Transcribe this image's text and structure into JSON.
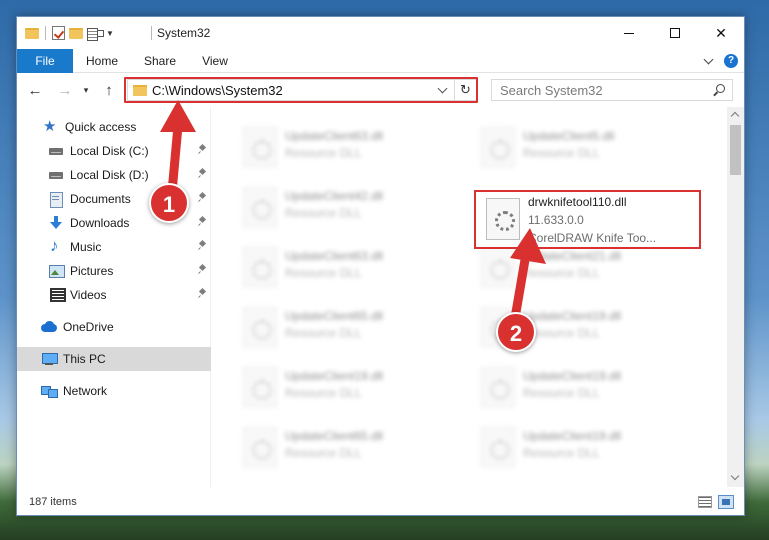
{
  "window": {
    "title": "System32",
    "controls": {
      "minimize": "—",
      "maximize": "☐",
      "close": "✕"
    }
  },
  "ribbon": {
    "tabs": [
      "File",
      "Home",
      "Share",
      "View"
    ],
    "help": "?"
  },
  "navigation": {
    "back": "←",
    "forward": "→",
    "recent": "▾",
    "up": "↑",
    "address": "C:\\Windows\\System32",
    "refresh": "↻",
    "search_placeholder": "Search System32"
  },
  "sidebar": {
    "items": [
      {
        "label": "Quick access",
        "icon": "star-icon",
        "pinned": false
      },
      {
        "label": "Local Disk (C:)",
        "icon": "disk-icon",
        "pinned": true
      },
      {
        "label": "Local Disk (D:)",
        "icon": "disk-icon",
        "pinned": true
      },
      {
        "label": "Documents",
        "icon": "documents-icon",
        "pinned": true
      },
      {
        "label": "Downloads",
        "icon": "downloads-icon",
        "pinned": true
      },
      {
        "label": "Music",
        "icon": "music-icon",
        "pinned": true
      },
      {
        "label": "Pictures",
        "icon": "pictures-icon",
        "pinned": true
      },
      {
        "label": "Videos",
        "icon": "videos-icon",
        "pinned": true
      },
      {
        "label": "OneDrive",
        "icon": "onedrive-icon",
        "pinned": false
      },
      {
        "label": "This PC",
        "icon": "pc-icon",
        "pinned": false,
        "selected": true
      },
      {
        "label": "Network",
        "icon": "network-icon",
        "pinned": false
      }
    ]
  },
  "files": {
    "left_column": [
      {
        "name": "UpdateClient63.dll",
        "type": "Resource DLL"
      },
      {
        "name": "UpdateClient42.dll",
        "type": "Resource DLL"
      },
      {
        "name": "UpdateClient63.dll",
        "type": "Resource DLL"
      },
      {
        "name": "UpdateClient65.dll",
        "type": "Resource DLL"
      },
      {
        "name": "UpdateClient19.dll",
        "type": "Resource DLL"
      },
      {
        "name": "UpdateClient65.dll",
        "type": "Resource DLL"
      }
    ],
    "right_column": [
      {
        "name": "UpdateClient5.dll",
        "type": "Resource DLL"
      },
      {
        "name": "UpdateClient21.dll",
        "type": "Resource DLL"
      },
      {
        "name": "UpdateClient19.dll",
        "type": "Resource DLL"
      },
      {
        "name": "UpdateClient19.dll",
        "type": "Resource DLL"
      },
      {
        "name": "UpdateClient19.dll",
        "type": "Resource DLL"
      }
    ],
    "highlighted": {
      "name": "drwknifetool110.dll",
      "version": "11.633.0.0",
      "description": "CorelDRAW Knife Too..."
    }
  },
  "status": {
    "item_count": "187 items"
  },
  "annotations": {
    "marker1": "1",
    "marker2": "2",
    "color": "#d8312f"
  }
}
